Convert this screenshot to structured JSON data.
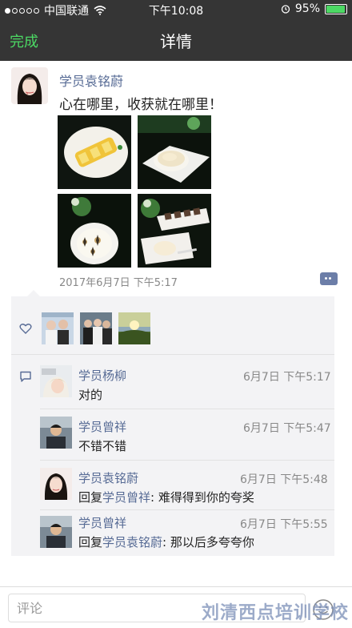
{
  "status_bar": {
    "carrier": "中国联通",
    "time": "下午10:08",
    "battery": "95%"
  },
  "nav": {
    "back_label": "完成",
    "title": "详情"
  },
  "post": {
    "author": "学员袁铭蔚",
    "text": "心在哪里，收获就在哪里！",
    "time": "2017年6月7日 下午5:17"
  },
  "comments": [
    {
      "name": "学员杨柳",
      "time": "6月7日 下午5:17",
      "text": "对的"
    },
    {
      "name": "学员曾祥",
      "time": "6月7日 下午5:47",
      "text": "不错不错"
    },
    {
      "name": "学员袁铭蔚",
      "time": "6月7日 下午5:48",
      "reply_prefix": "回复",
      "reply_to": "学员曾祥",
      "reply_text": ": 难得得到你的夸奖"
    },
    {
      "name": "学员曾祥",
      "time": "6月7日 下午5:55",
      "reply_prefix": "回复",
      "reply_to": "学员袁铭蔚",
      "reply_text": ": 那以后多夸夸你"
    }
  ],
  "input": {
    "placeholder": "评论"
  },
  "watermark": "刘清西点培训学校",
  "colors": {
    "nav_bg": "#353535",
    "accent_green": "#4cd964",
    "link_blue": "#576b95"
  }
}
